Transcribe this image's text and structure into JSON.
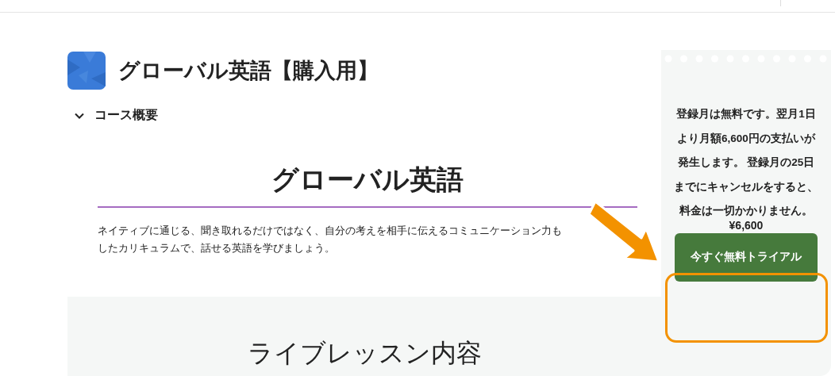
{
  "course": {
    "title": "グローバル英語【購入用】"
  },
  "overview": {
    "label": "コース概要",
    "expanded": true
  },
  "article": {
    "heading": "グローバル英語",
    "lines": [
      "ネイティブに通じる、聞き取れるだけではなく、自分の考えを相手に伝えるコミュニケーション力も",
      "したカリキュラムで、話せる英語を学びましょう。"
    ]
  },
  "section": {
    "heading": "ライブレッスン内容"
  },
  "sidebar": {
    "notice": "登録月は無料です。翌月1日より月額6,600円の支払いが発生します。 登録月の25日までにキャンセルをすると、料金は一切かかりません。",
    "price": "¥6,600",
    "button": "今すぐ無料トライアル"
  }
}
